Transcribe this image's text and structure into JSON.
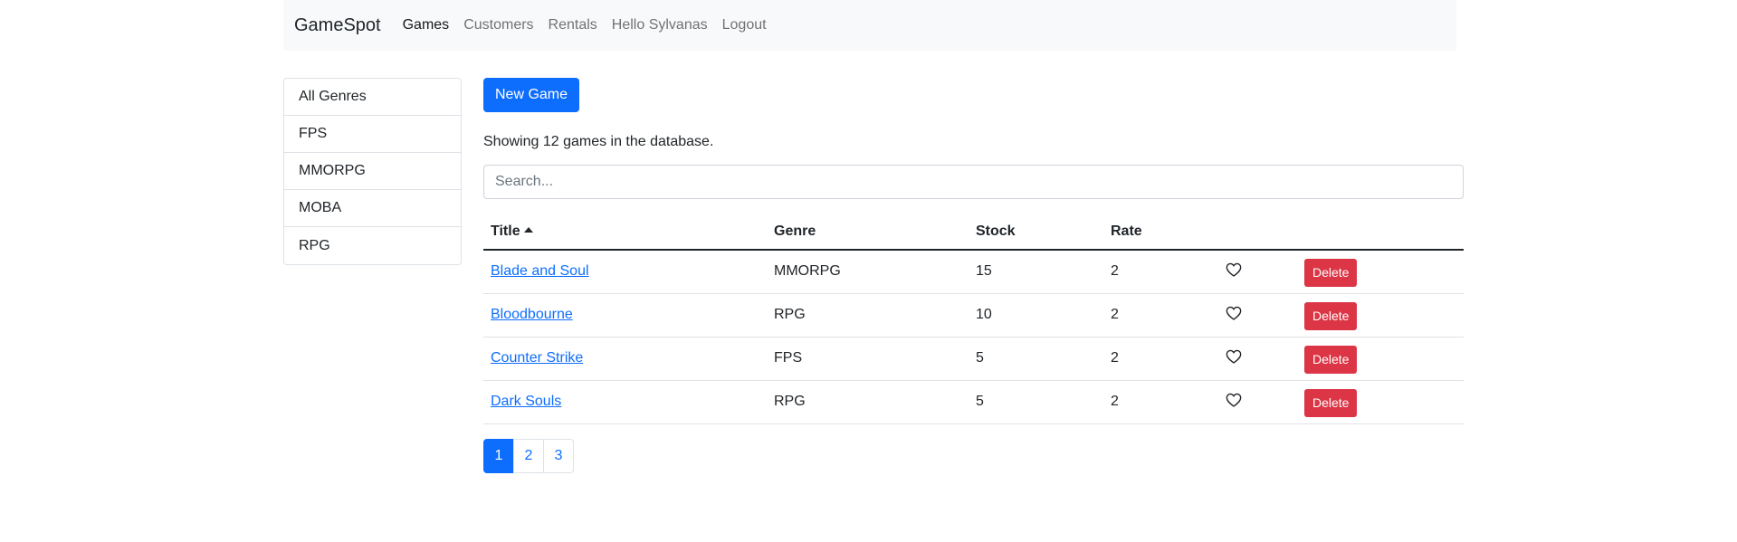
{
  "navbar": {
    "brand": "GameSpot",
    "links": [
      {
        "label": "Games",
        "active": true
      },
      {
        "label": "Customers",
        "active": false
      },
      {
        "label": "Rentals",
        "active": false
      },
      {
        "label": "Hello Sylvanas",
        "active": false
      },
      {
        "label": "Logout",
        "active": false
      }
    ]
  },
  "genres": [
    "All Genres",
    "FPS",
    "MMORPG",
    "MOBA",
    "RPG"
  ],
  "main": {
    "new_game_label": "New Game",
    "summary": "Showing 12 games in the database.",
    "search_placeholder": "Search...",
    "search_value": ""
  },
  "table": {
    "columns": [
      "Title",
      "Genre",
      "Stock",
      "Rate"
    ],
    "sort_column": "Title",
    "sort_direction": "asc",
    "delete_label": "Delete",
    "rows": [
      {
        "title": "Blade and Soul",
        "genre": "MMORPG",
        "stock": "15",
        "rate": "2",
        "liked": false
      },
      {
        "title": "Bloodbourne",
        "genre": "RPG",
        "stock": "10",
        "rate": "2",
        "liked": false
      },
      {
        "title": "Counter Strike",
        "genre": "FPS",
        "stock": "5",
        "rate": "2",
        "liked": false
      },
      {
        "title": "Dark Souls",
        "genre": "RPG",
        "stock": "5",
        "rate": "2",
        "liked": false
      }
    ]
  },
  "pagination": {
    "pages": [
      "1",
      "2",
      "3"
    ],
    "current": "1"
  },
  "colors": {
    "primary": "#0d6efd",
    "danger": "#dc3545",
    "navbar_bg": "#f8f9fa"
  },
  "icons": {
    "like": "heart-outline-icon",
    "sort": "caret-up-icon"
  }
}
